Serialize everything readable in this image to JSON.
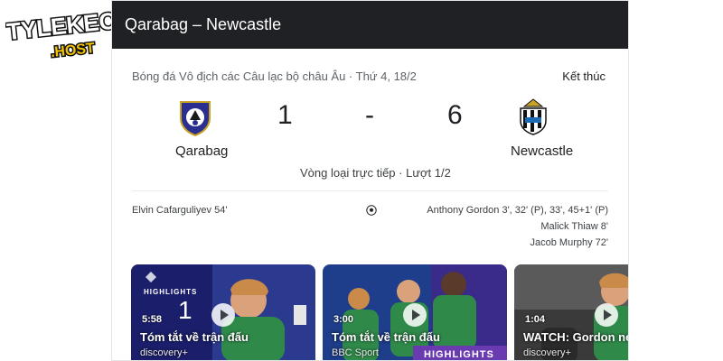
{
  "logo": {
    "text_top": "TYLEKEO",
    "text_bottom": ".HOST"
  },
  "header": {
    "title": "Qarabag – Newcastle"
  },
  "match": {
    "competition_line": "Bóng đá Vô địch các Câu lạc bộ châu Âu · Thứ 4, 18/2",
    "status": "Kết thúc",
    "home": {
      "name": "Qarabag",
      "score": "1",
      "crest_icon": "qarabag-crest-icon"
    },
    "away": {
      "name": "Newcastle",
      "score": "6",
      "crest_icon": "newcastle-crest-icon"
    },
    "separator": "-",
    "round": "Vòng loại trực tiếp · Lượt 1/2",
    "home_scorers": [
      "Elvin Cafarguliyev 54'"
    ],
    "away_scorers": [
      "Anthony Gordon 3', 32' (P), 33', 45+1' (P)",
      "Malick Thiaw 8'",
      "Jacob Murphy 72'"
    ]
  },
  "videos": [
    {
      "duration": "5:58",
      "title": "Tóm tắt về trận đấu",
      "source": "discovery+",
      "badge": "HIGHLIGHTS"
    },
    {
      "duration": "3:00",
      "title": "Tóm tắt về trận đấu",
      "source": "BBC Sport",
      "badge": "HIGHLIGHTS"
    },
    {
      "duration": "1:04",
      "title": "WATCH: Gordon nets",
      "source": "discovery+"
    }
  ],
  "colors": {
    "header_bg": "#202124",
    "champions_blue": "#1b1f6b",
    "newcastle_green": "#1f7a3c"
  }
}
